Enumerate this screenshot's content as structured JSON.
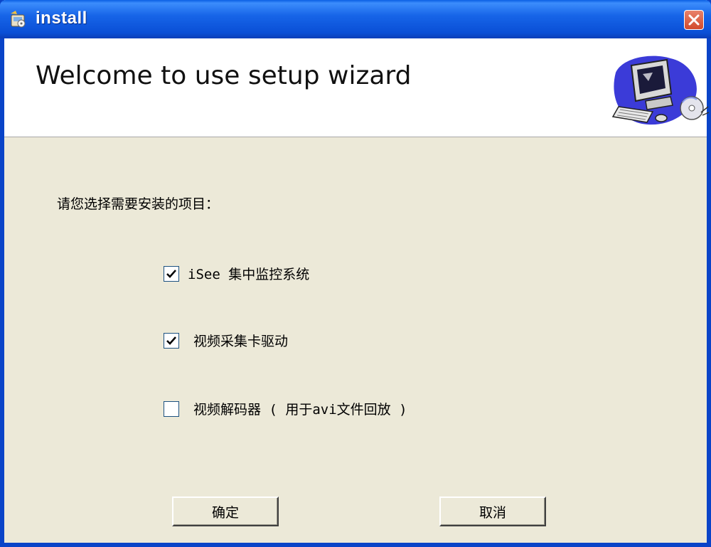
{
  "window": {
    "title": "install",
    "icon": "installer-app-icon",
    "close_icon": "close-icon"
  },
  "header": {
    "title": "Welcome to use setup wizard",
    "graphic": "computer-setup-illustration"
  },
  "body": {
    "prompt": "请您选择需要安装的项目：",
    "options": [
      {
        "label": "iSee 集中监控系统",
        "checked": true
      },
      {
        "label": "视频采集卡驱动",
        "checked": true
      },
      {
        "label": "视频解码器 ( 用于avi文件回放 )",
        "checked": false
      }
    ]
  },
  "buttons": {
    "ok_label": "确定",
    "cancel_label": "取消"
  },
  "colors": {
    "titlebar": "#0a4fd6",
    "dialog_bg": "#ece9d8",
    "close_button": "#d24a2c"
  }
}
